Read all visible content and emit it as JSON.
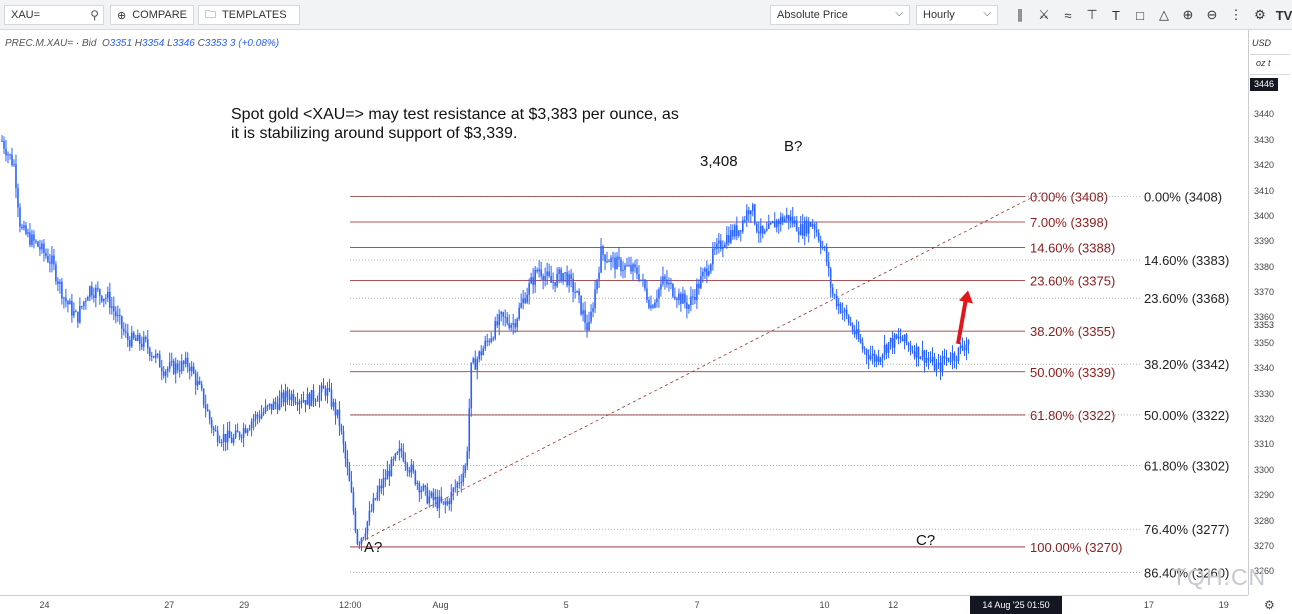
{
  "toolbar": {
    "symbol": "XAU=",
    "compare": "COMPARE",
    "templates": "TEMPLATES",
    "scale": "Absolute Price",
    "interval": "Hourly",
    "icons": [
      "candle-icon",
      "indicator-icon",
      "wave-icon",
      "crosshair-icon",
      "text-icon",
      "select-icon",
      "shape-icon",
      "zoom-in-icon",
      "zoom-out-icon",
      "more-icon",
      "settings-icon",
      "logo-icon"
    ]
  },
  "instrument": {
    "name": "PREC.M.XAU= · Bid",
    "open_label": "O",
    "open": "3351",
    "high_label": "H",
    "high": "3354",
    "low_label": "L",
    "low": "3346",
    "close_label": "C",
    "close": "3353",
    "change": "3 (+0.08%)"
  },
  "annotation": "Spot gold <XAU=> may test resistance at $3,383 per ounce, as it is stabilizing around support of $3,339.",
  "wave_labels": {
    "peak": "3,408",
    "b": "B?",
    "a": "A?",
    "c": "C?"
  },
  "axis": {
    "currency": "USD",
    "unit": "oz t",
    "last_price_tag": "3446",
    "current_price_label": "3353",
    "date_tag": "14 Aug '25   01:50",
    "watermark": "TQH.CN"
  },
  "colors": {
    "candles": "#2962ff",
    "fib_red": "#8b1c1c",
    "fib_gray": "#808080",
    "trend": "#a03030",
    "arrow": "#e0161a"
  },
  "chart_data": {
    "type": "candlestick",
    "ylim": [
      3255,
      3450
    ],
    "yticks": [
      3260,
      3270,
      3280,
      3290,
      3300,
      3310,
      3320,
      3330,
      3340,
      3350,
      3360,
      3370,
      3380,
      3390,
      3400,
      3410,
      3420,
      3430,
      3440
    ],
    "xticks": [
      {
        "label": "24",
        "t": 0.03
      },
      {
        "label": "27",
        "t": 0.13
      },
      {
        "label": "29",
        "t": 0.19
      },
      {
        "label": "12:00",
        "t": 0.27
      },
      {
        "label": "Aug",
        "t": 0.345
      },
      {
        "label": "5",
        "t": 0.45
      },
      {
        "label": "7",
        "t": 0.555
      },
      {
        "label": "10",
        "t": 0.655
      },
      {
        "label": "12",
        "t": 0.71
      },
      {
        "label": "14 Aug '25",
        "t": 0.8
      },
      {
        "label": "17",
        "t": 0.915
      },
      {
        "label": "19",
        "t": 0.975
      }
    ],
    "price_path": [
      [
        0,
        3430
      ],
      [
        0.01,
        3420
      ],
      [
        0.015,
        3395
      ],
      [
        0.03,
        3388
      ],
      [
        0.04,
        3382
      ],
      [
        0.05,
        3368
      ],
      [
        0.06,
        3360
      ],
      [
        0.07,
        3372
      ],
      [
        0.085,
        3368
      ],
      [
        0.1,
        3352
      ],
      [
        0.115,
        3350
      ],
      [
        0.13,
        3340
      ],
      [
        0.15,
        3342
      ],
      [
        0.16,
        3330
      ],
      [
        0.17,
        3315
      ],
      [
        0.185,
        3312
      ],
      [
        0.2,
        3320
      ],
      [
        0.215,
        3325
      ],
      [
        0.23,
        3330
      ],
      [
        0.245,
        3328
      ],
      [
        0.26,
        3332
      ],
      [
        0.27,
        3320
      ],
      [
        0.28,
        3290
      ],
      [
        0.285,
        3272
      ],
      [
        0.29,
        3276
      ],
      [
        0.3,
        3290
      ],
      [
        0.31,
        3300
      ],
      [
        0.32,
        3308
      ],
      [
        0.33,
        3298
      ],
      [
        0.34,
        3290
      ],
      [
        0.355,
        3286
      ],
      [
        0.365,
        3295
      ],
      [
        0.372,
        3302
      ],
      [
        0.376,
        3340
      ],
      [
        0.39,
        3352
      ],
      [
        0.4,
        3360
      ],
      [
        0.41,
        3358
      ],
      [
        0.42,
        3370
      ],
      [
        0.43,
        3380
      ],
      [
        0.44,
        3374
      ],
      [
        0.45,
        3378
      ],
      [
        0.46,
        3370
      ],
      [
        0.47,
        3355
      ],
      [
        0.48,
        3386
      ],
      [
        0.49,
        3382
      ],
      [
        0.5,
        3380
      ],
      [
        0.51,
        3378
      ],
      [
        0.52,
        3365
      ],
      [
        0.53,
        3375
      ],
      [
        0.54,
        3370
      ],
      [
        0.55,
        3365
      ],
      [
        0.56,
        3375
      ],
      [
        0.57,
        3385
      ],
      [
        0.58,
        3392
      ],
      [
        0.59,
        3395
      ],
      [
        0.6,
        3405
      ],
      [
        0.605,
        3396
      ],
      [
        0.61,
        3392
      ],
      [
        0.62,
        3398
      ],
      [
        0.63,
        3400
      ],
      [
        0.64,
        3395
      ],
      [
        0.65,
        3398
      ],
      [
        0.66,
        3385
      ],
      [
        0.665,
        3370
      ],
      [
        0.675,
        3362
      ],
      [
        0.69,
        3348
      ],
      [
        0.7,
        3344
      ],
      [
        0.71,
        3350
      ],
      [
        0.72,
        3352
      ],
      [
        0.73,
        3348
      ],
      [
        0.74,
        3345
      ],
      [
        0.75,
        3340
      ],
      [
        0.755,
        3344
      ],
      [
        0.765,
        3346
      ],
      [
        0.775,
        3352
      ]
    ],
    "trendline": {
      "from": [
        0.285,
        3272
      ],
      "to": [
        0.82,
        3410
      ]
    },
    "fib_levels_red": [
      {
        "label": "0.00% (3408)",
        "y": 3408
      },
      {
        "label": "7.00% (3398)",
        "y": 3398
      },
      {
        "label": "14.60% (3388)",
        "y": 3388
      },
      {
        "label": "23.60% (3375)",
        "y": 3375
      },
      {
        "label": "38.20% (3355)",
        "y": 3355
      },
      {
        "label": "50.00% (3339)",
        "y": 3339
      },
      {
        "label": "61.80% (3322)",
        "y": 3322
      },
      {
        "label": "100.00% (3270)",
        "y": 3270
      }
    ],
    "fib_levels_gray": [
      {
        "label": "0.00% (3408)",
        "y": 3408
      },
      {
        "label": "14.60% (3383)",
        "y": 3383
      },
      {
        "label": "23.60% (3368)",
        "y": 3368
      },
      {
        "label": "38.20% (3342)",
        "y": 3342
      },
      {
        "label": "50.00% (3322)",
        "y": 3322
      },
      {
        "label": "61.80% (3302)",
        "y": 3302
      },
      {
        "label": "76.40% (3277)",
        "y": 3277
      },
      {
        "label": "86.40% (3260)",
        "y": 3260
      }
    ]
  }
}
